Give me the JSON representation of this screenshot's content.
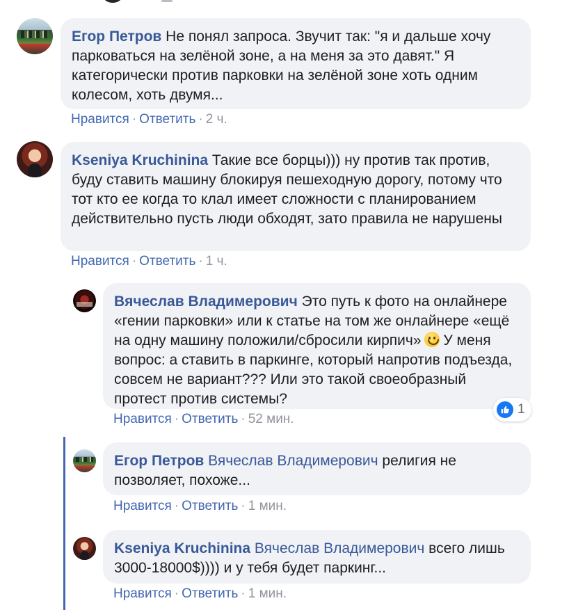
{
  "comments": [
    {
      "author": "Егор Петров",
      "mention": "",
      "text": "Не понял запроса. Звучит так: \"я и дальше хочу парковаться на зелёной зоне, а на меня за это давят.\" Я категорически против парковки на зелёной зоне хоть одним колесом, хоть двумя...",
      "like": "Нравится",
      "reply": "Ответить",
      "time": "2 ч."
    },
    {
      "author": "Kseniya Kruchinina",
      "mention": "",
      "text": "Такие все борцы))) ну против так против, буду ставить машину блокируя пешеходную дорогу, потому что тот кто ее когда то клал имеет сложности с планированием действительно пусть люди обходят, зато правила не нарушены",
      "like": "Нравится",
      "reply": "Ответить",
      "time": "1 ч."
    },
    {
      "author": "Вячеслав Владимерович",
      "mention": "",
      "text": "Это путь к фото на онлайнере «гении парковки» или к статье на том же онлайнере «ещё на одну машину положили/сбросили кирпич»",
      "text2": "У меня вопрос: а ставить в паркинге, который напротив подъезда, совсем не вариант??? Или это такой своеобразный протест против системы?",
      "emoji": "smiley-emoji",
      "reaction_count": "1",
      "like": "Нравится",
      "reply": "Ответить",
      "time": "52 мин."
    },
    {
      "author": "Егор Петров",
      "mention": "Вячеслав Владимерович",
      "text": "религия не позволяет, похоже...",
      "like": "Нравится",
      "reply": "Ответить",
      "time": "1 мин."
    },
    {
      "author": "Kseniya Kruchinina",
      "mention": "Вячеслав Владимерович",
      "text": "всего лишь 3000-18000$)))) и у тебя будет паркинг...",
      "like": "Нравится",
      "reply": "Ответить",
      "time": "1 мин."
    }
  ],
  "separator": "·",
  "colors": {
    "link": "#385898",
    "meta_link": "#4267b2",
    "meta_text": "#90949c",
    "bubble_bg": "#f0f2f5",
    "thread_line": "#4267b2",
    "like_blue": "#1877f2"
  },
  "icons": {
    "like": "thumbs-up-icon"
  }
}
